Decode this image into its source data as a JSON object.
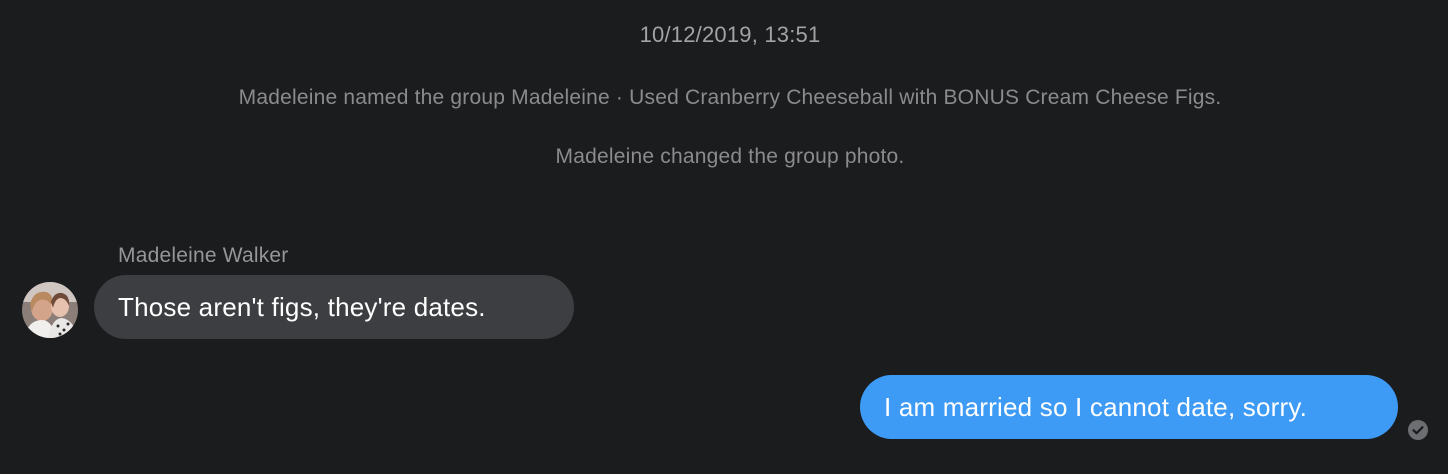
{
  "thread": {
    "timestamp": "10/12/2019, 13:51",
    "events": [
      "Madeleine named the group Madeleine · Used Cranberry Cheeseball with BONUS Cream Cheese Figs.",
      "Madeleine changed the group photo."
    ]
  },
  "messages": [
    {
      "sender": "Madeleine Walker",
      "text": "Those aren't figs, they're dates.",
      "avatar_icon": "avatar-photo"
    },
    {
      "text": "I am married so I cannot date, sorry.",
      "status_icon": "check-circle-icon"
    }
  ],
  "colors": {
    "background": "#1b1c1e",
    "incoming_bubble": "#3d3e41",
    "outgoing_bubble": "#3e9bf5",
    "meta_text": "#8b8b8e"
  }
}
